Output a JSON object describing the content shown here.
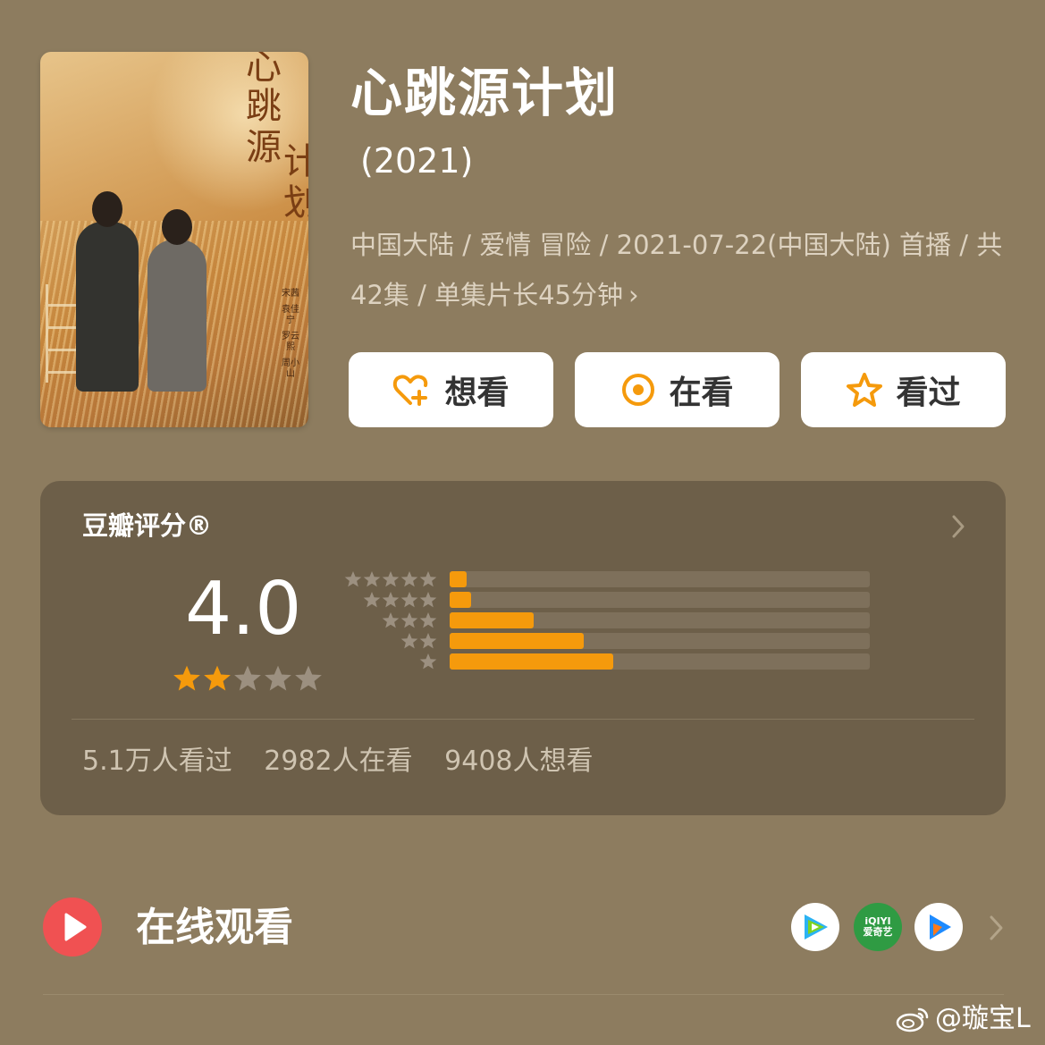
{
  "poster": {
    "title_chars": [
      "心",
      "跳",
      "源",
      "计",
      "划"
    ],
    "cast": [
      "宋茜",
      "袁佳宁",
      "罗云熙",
      "周小山"
    ]
  },
  "movie": {
    "title": "心跳源计划",
    "year": "(2021)",
    "meta_line": "中国大陆 / 爱情 冒险 / 2021-07-22(中国大陆) 首播 / 共42集 / 单集片长45分钟",
    "meta_chevron": "›"
  },
  "actions": {
    "want_label": "想看",
    "watching_label": "在看",
    "watched_label": "看过",
    "accent_color": "#f59a0c"
  },
  "rating": {
    "label": "豆瓣评分®",
    "score": "4.0",
    "stars_filled": 2,
    "stars_total": 5,
    "distribution": [
      {
        "stars": 5,
        "fraction": 0.04
      },
      {
        "stars": 4,
        "fraction": 0.05
      },
      {
        "stars": 3,
        "fraction": 0.2
      },
      {
        "stars": 2,
        "fraction": 0.32
      },
      {
        "stars": 1,
        "fraction": 0.39
      }
    ],
    "stats": [
      "5.1万人看过",
      "2982人在看",
      "9408人想看"
    ]
  },
  "online": {
    "title": "在线观看",
    "platforms": [
      "tencent-video-icon",
      "iqiyi-icon",
      "youku-icon"
    ],
    "iqiyi_text_top": "iQIYI",
    "iqiyi_text_bottom": "爱奇艺"
  },
  "watermark": {
    "text": "@璇宝L"
  },
  "colors": {
    "background": "#8d7c5f",
    "card": "#6d5f49",
    "star_active": "#f59a0c",
    "star_inactive": "#9c9080",
    "play_red": "#f05152"
  }
}
